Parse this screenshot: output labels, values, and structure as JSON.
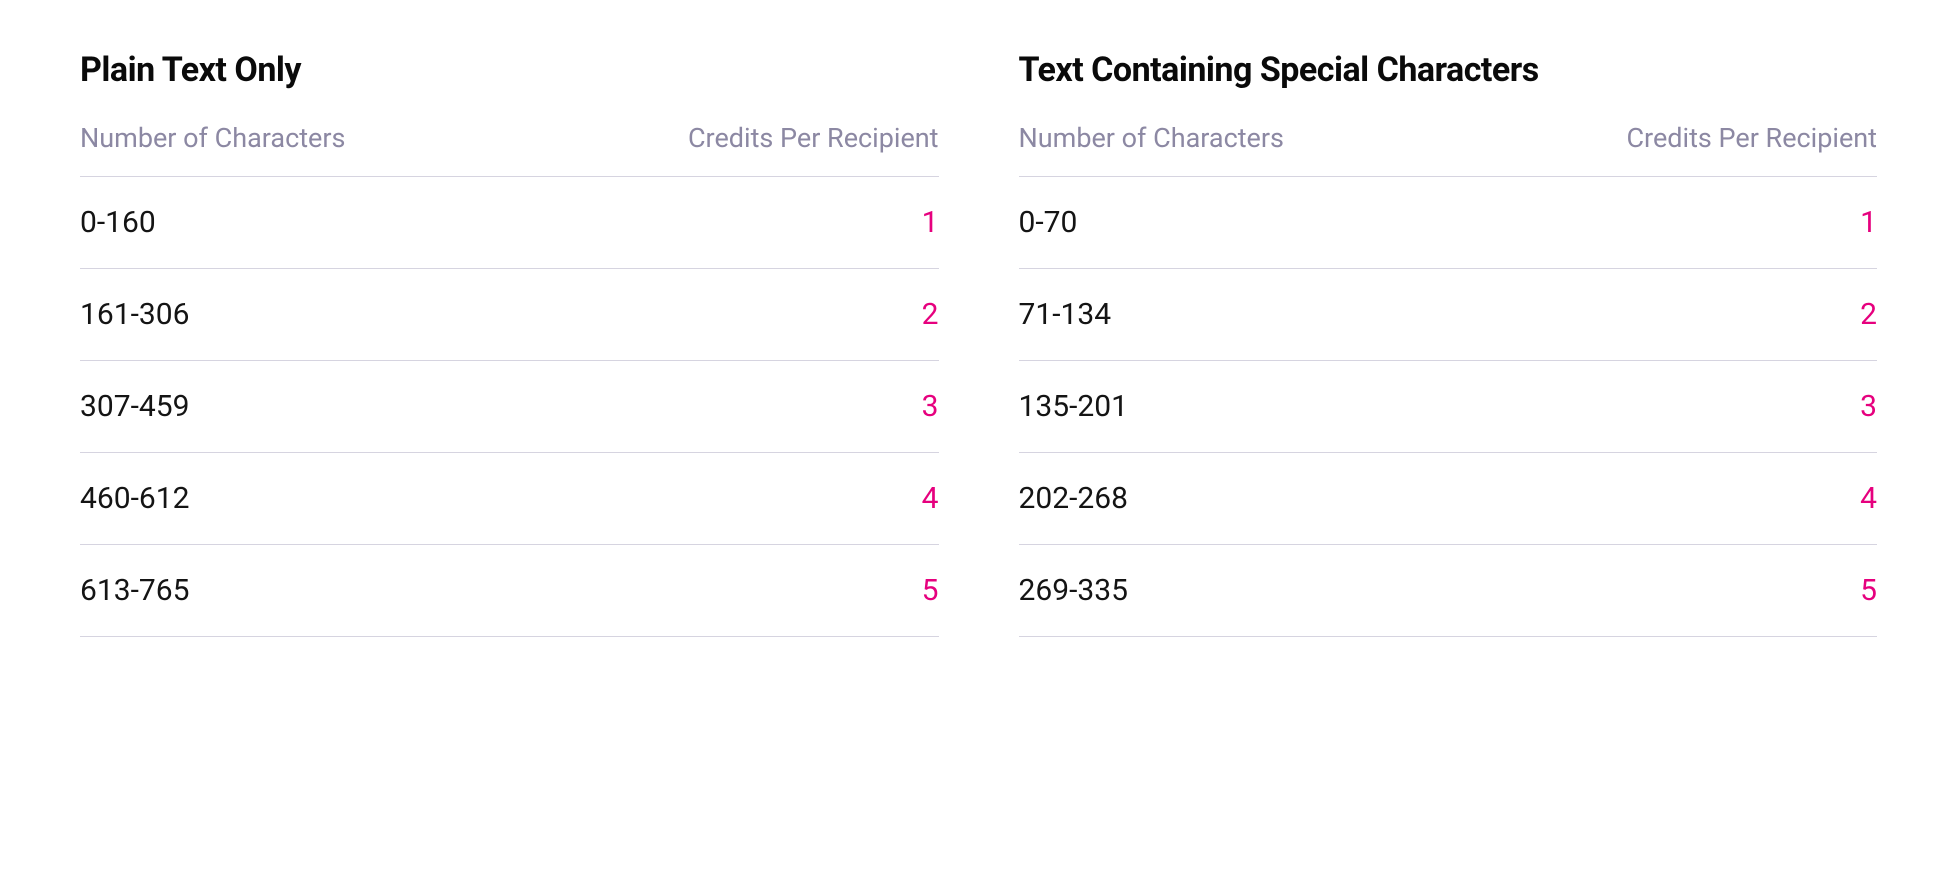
{
  "tables": [
    {
      "title": "Plain Text Only",
      "columns": {
        "left": "Number of Characters",
        "right": "Credits Per Recipient"
      },
      "rows": [
        {
          "range": "0-160",
          "credits": "1"
        },
        {
          "range": "161-306",
          "credits": "2"
        },
        {
          "range": "307-459",
          "credits": "3"
        },
        {
          "range": "460-612",
          "credits": "4"
        },
        {
          "range": "613-765",
          "credits": "5"
        }
      ]
    },
    {
      "title": "Text Containing Special Characters",
      "columns": {
        "left": "Number of Characters",
        "right": "Credits Per Recipient"
      },
      "rows": [
        {
          "range": "0-70",
          "credits": "1"
        },
        {
          "range": "71-134",
          "credits": "2"
        },
        {
          "range": "135-201",
          "credits": "3"
        },
        {
          "range": "202-268",
          "credits": "4"
        },
        {
          "range": "269-335",
          "credits": "5"
        }
      ]
    }
  ]
}
